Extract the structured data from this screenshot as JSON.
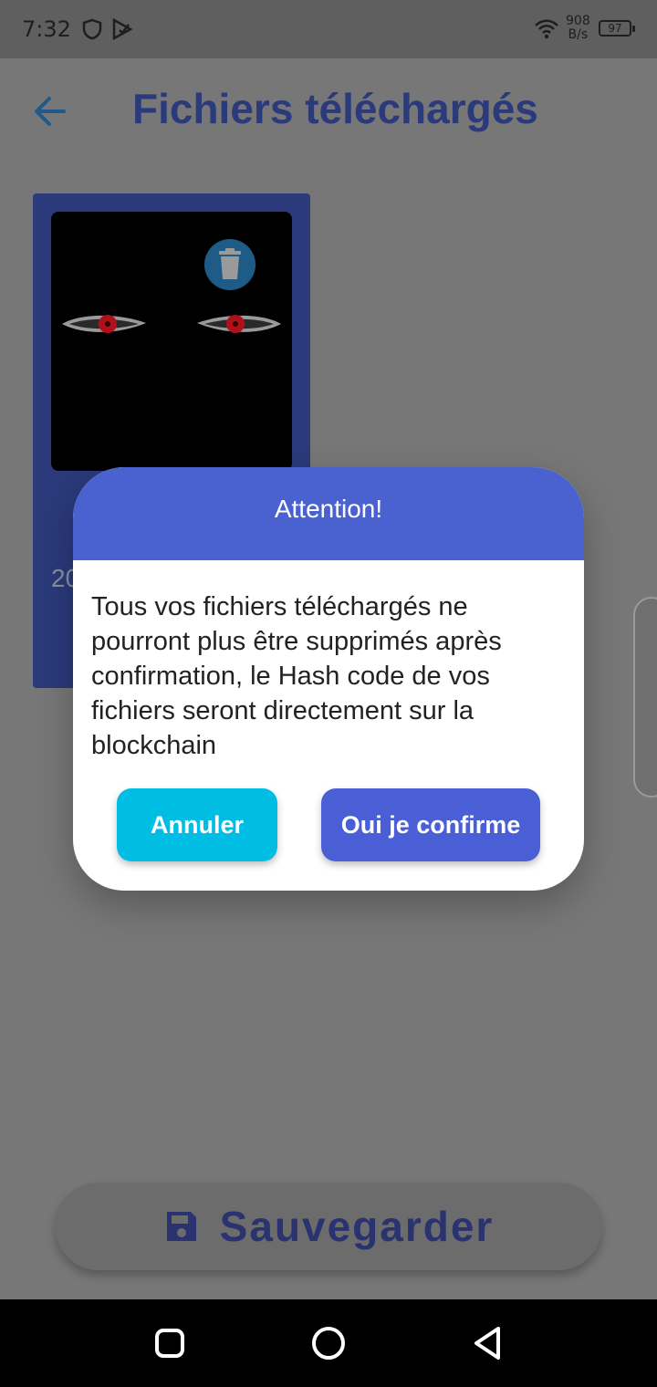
{
  "status_bar": {
    "time": "7:32",
    "net_speed_value": "908",
    "net_speed_unit": "B/s",
    "battery": "97"
  },
  "app_bar": {
    "title": "Fichiers téléchargés"
  },
  "file_card": {
    "date_partial": "20"
  },
  "dialog": {
    "title": "Attention!",
    "message": "Tous vos fichiers téléchargés ne pourront plus être supprimés après confirmation, le Hash code de vos fichiers seront directement sur la blockchain",
    "cancel_label": "Annuler",
    "confirm_label": "Oui je confirme"
  },
  "save_button": {
    "label": "Sauvegarder"
  },
  "colors": {
    "primary": "#4a62d0",
    "cancel": "#00bde4",
    "confirm": "#4a5ed6",
    "title": "#2a3a7a"
  },
  "icons": [
    "shield-icon",
    "play-store-icon",
    "wifi-icon",
    "battery-icon",
    "back-arrow-icon",
    "trash-icon",
    "save-floppy-icon",
    "nav-recents-icon",
    "nav-home-icon",
    "nav-back-icon"
  ]
}
